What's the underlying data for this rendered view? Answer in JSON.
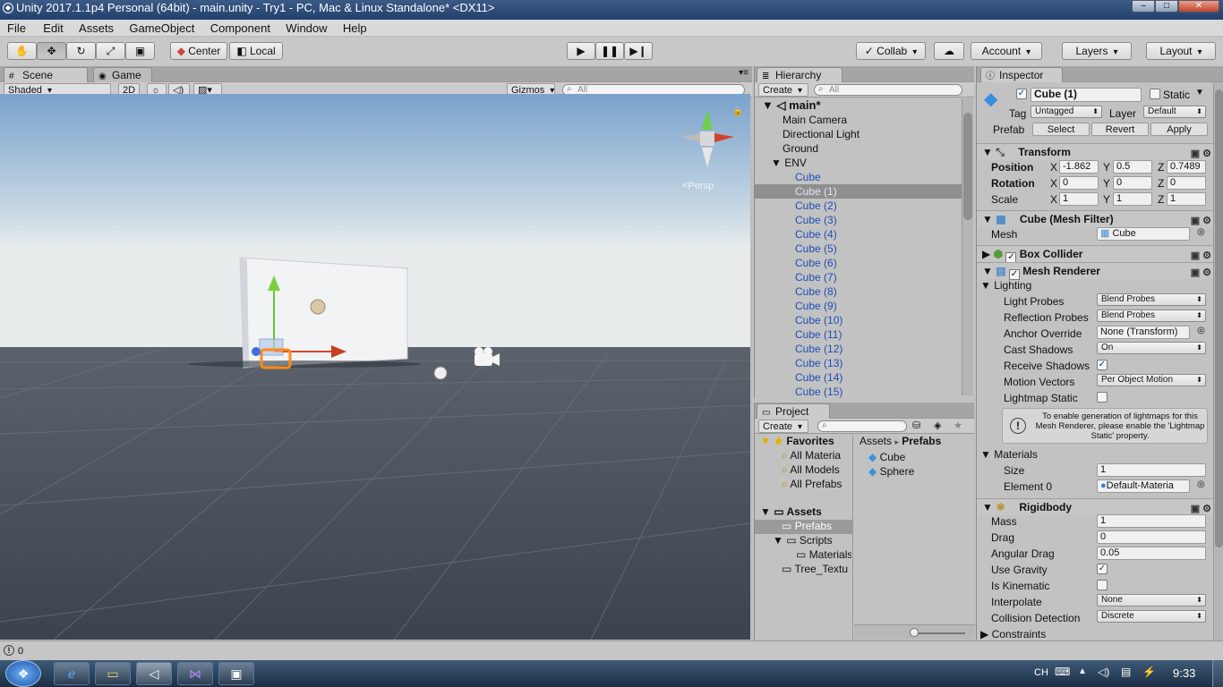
{
  "window": {
    "title": "Unity 2017.1.1p4 Personal (64bit) - main.unity - Try1 - PC, Mac & Linux Standalone* <DX11>"
  },
  "menu": [
    "File",
    "Edit",
    "Assets",
    "GameObject",
    "Component",
    "Window",
    "Help"
  ],
  "toolbar": {
    "center": "Center",
    "local": "Local",
    "collab": "Collab",
    "account": "Account",
    "layers": "Layers",
    "layout": "Layout"
  },
  "scene": {
    "tab_scene": "Scene",
    "tab_game": "Game",
    "shading": "Shaded",
    "mode2d": "2D",
    "gizmos": "Gizmos",
    "search": "All",
    "persp": "<Persp"
  },
  "hierarchy": {
    "tab": "Hierarchy",
    "create": "Create",
    "search": "All",
    "scene_name": "main*",
    "items": [
      "Main Camera",
      "Directional Light",
      "Ground",
      "ENV",
      "Cube",
      "Cube (1)",
      "Cube (2)",
      "Cube (3)",
      "Cube (4)",
      "Cube (5)",
      "Cube (6)",
      "Cube (7)",
      "Cube (8)",
      "Cube (9)",
      "Cube (10)",
      "Cube (11)",
      "Cube (12)",
      "Cube (13)",
      "Cube (14)",
      "Cube (15)"
    ]
  },
  "project": {
    "tab": "Project",
    "create": "Create",
    "favorites": "Favorites",
    "fav_items": [
      "All Materia",
      "All Models",
      "All Prefabs"
    ],
    "assets": "Assets",
    "asset_items": [
      "Prefabs",
      "Scripts",
      "Materials",
      "Tree_Textu"
    ],
    "crumb_root": "Assets",
    "crumb_sep": "▸",
    "crumb_leaf": "Prefabs",
    "files": [
      "Cube",
      "Sphere"
    ]
  },
  "inspector": {
    "tab": "Inspector",
    "name": "Cube (1)",
    "static": "Static",
    "tag_label": "Tag",
    "tag": "Untagged",
    "layer_label": "Layer",
    "layer": "Default",
    "prefab_label": "Prefab",
    "select": "Select",
    "revert": "Revert",
    "apply": "Apply",
    "transform": "Transform",
    "position": "Position",
    "rotation": "Rotation",
    "scale": "Scale",
    "x": "X",
    "y": "Y",
    "z": "Z",
    "pos": [
      "-1.862",
      "0.5",
      "0.7489"
    ],
    "rot": [
      "0",
      "0",
      "0"
    ],
    "scl": [
      "1",
      "1",
      "1"
    ],
    "mesh_filter": "Cube (Mesh Filter)",
    "mesh_label": "Mesh",
    "mesh": "Cube",
    "box_collider": "Box Collider",
    "mesh_renderer": "Mesh Renderer",
    "lighting": "Lighting",
    "light_probes_label": "Light Probes",
    "light_probes": "Blend Probes",
    "reflection_probes_label": "Reflection Probes",
    "reflection_probes": "Blend Probes",
    "anchor_label": "Anchor Override",
    "anchor": "None (Transform)",
    "cast_shadows_label": "Cast Shadows",
    "cast_shadows": "On",
    "receive_shadows_label": "Receive Shadows",
    "motion_vectors_label": "Motion Vectors",
    "motion_vectors": "Per Object Motion",
    "lightmap_static_label": "Lightmap Static",
    "help_text": "To enable generation of lightmaps for this Mesh Renderer, please enable the 'Lightmap Static' property.",
    "materials": "Materials",
    "size_label": "Size",
    "size": "1",
    "element0_label": "Element 0",
    "element0": "Default-Materia",
    "rigidbody": "Rigidbody",
    "mass_label": "Mass",
    "mass": "1",
    "drag_label": "Drag",
    "drag": "0",
    "angular_drag_label": "Angular Drag",
    "angular_drag": "0.05",
    "use_gravity_label": "Use Gravity",
    "is_kinematic_label": "Is Kinematic",
    "interpolate_label": "Interpolate",
    "interpolate": "None",
    "collision_label": "Collision Detection",
    "collision": "Discrete",
    "constraints": "Constraints"
  },
  "status": {
    "count": "0"
  },
  "taskbar": {
    "lang": "CH",
    "time": "9:33"
  }
}
